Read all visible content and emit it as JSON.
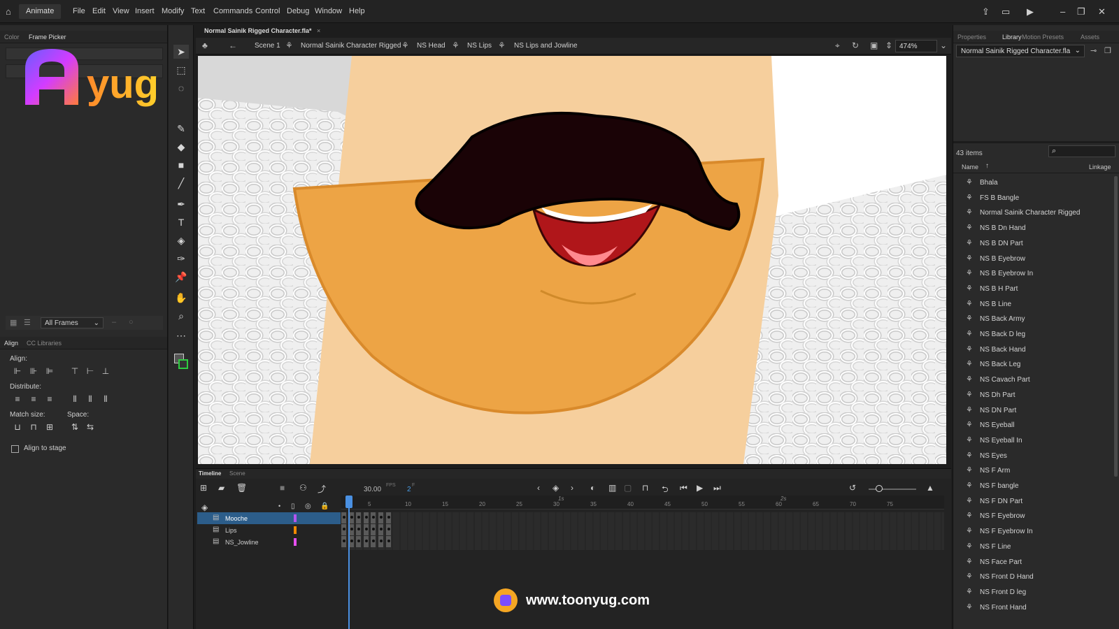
{
  "app": {
    "name": "Animate"
  },
  "menu": [
    "File",
    "Edit",
    "View",
    "Insert",
    "Modify",
    "Text",
    "Commands",
    "Control",
    "Debug",
    "Window",
    "Help"
  ],
  "left_panel": {
    "tabs": [
      "Color",
      "Frame Picker"
    ],
    "filter_label": "All Frames",
    "align_tabs": [
      "Align",
      "CC Libraries"
    ],
    "align_label": "Align:",
    "distribute_label": "Distribute:",
    "match_size_label": "Match size:",
    "space_label": "Space:",
    "align_to_stage": "Align to stage"
  },
  "logo": {
    "text": "yug"
  },
  "document": {
    "tab_title": "Normal Sainik Rigged Character.fla*",
    "breadcrumbs": [
      "Scene 1",
      "Normal Sainik Character Rigged",
      "NS Head",
      "NS Lips",
      "NS Lips and Jowline"
    ],
    "zoom": "474%"
  },
  "timeline": {
    "tabs": [
      "Timeline",
      "Scene"
    ],
    "fps": "30.00",
    "fps_unit": "FPS",
    "current_frame": "2",
    "frame_unit": "F",
    "ruler_marks": [
      "5",
      "10",
      "15",
      "20",
      "25",
      "30",
      "35",
      "40",
      "45",
      "50",
      "55",
      "60",
      "65",
      "70",
      "75"
    ],
    "ruler_seconds": [
      "1s",
      "2s"
    ],
    "layers": [
      {
        "name": "Mooche",
        "color": "#b455f0",
        "selected": true
      },
      {
        "name": "Lips",
        "color": "#f08a00",
        "selected": false
      },
      {
        "name": "NS_Jowline",
        "color": "#e64ff0",
        "selected": false
      }
    ]
  },
  "right_panel": {
    "tabs": [
      "Properties",
      "Library",
      "Motion Presets",
      "Assets"
    ],
    "library_file": "Normal Sainik Rigged Character.fla",
    "item_count": "43 items",
    "col_name": "Name",
    "col_linkage": "Linkage",
    "items": [
      "Bhala",
      "FS B Bangle",
      "Normal Sainik Character Rigged",
      "NS B Dn Hand",
      "NS B DN Part",
      "NS B Eyebrow",
      "NS B Eyebrow In",
      "NS B H Part",
      "NS B Line",
      "NS Back Army",
      "NS Back D leg",
      "NS Back Hand",
      "NS Back Leg",
      "NS Cavach Part",
      "NS Dh Part",
      "NS DN Part",
      "NS Eyeball",
      "NS Eyeball In",
      "NS Eyes",
      "NS F Arm",
      "NS F bangle",
      "NS F DN Part",
      "NS F Eyebrow",
      "NS F Eyebrow In",
      "NS F Line",
      "NS Face Part",
      "NS Front D Hand",
      "NS Front D leg",
      "NS Front Hand"
    ]
  },
  "footer": {
    "url": "www.toonyug.com"
  },
  "colors": {
    "skin": "#f6cf9d",
    "jaw": "#eda445",
    "mustache": "#1a0306",
    "selected_layer": "#2c5d8a",
    "playhead": "#4a90e2"
  }
}
